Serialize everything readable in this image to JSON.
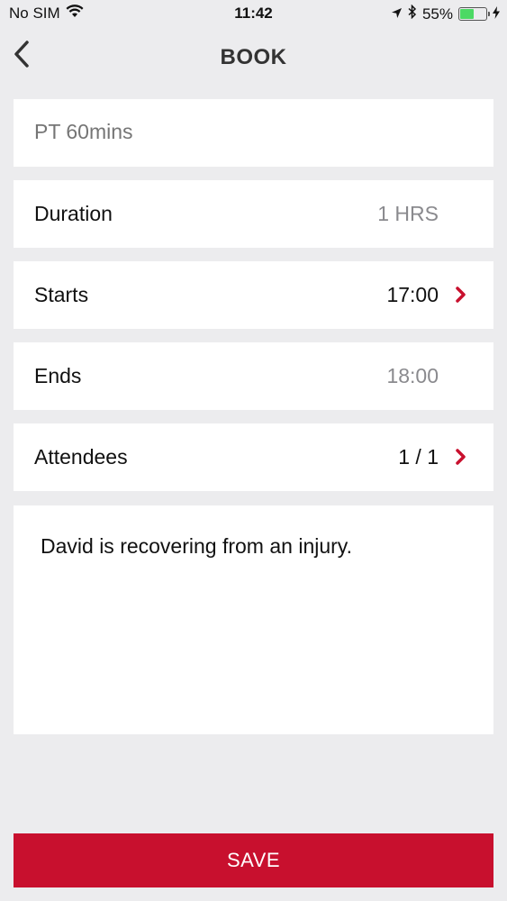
{
  "status_bar": {
    "carrier": "No SIM",
    "time": "11:42",
    "battery_percent": "55%",
    "battery_level": 0.55,
    "icons": [
      "wifi-icon",
      "location-arrow-icon",
      "bluetooth-icon",
      "battery-icon",
      "charging-bolt-icon"
    ]
  },
  "nav": {
    "title": "BOOK",
    "back_icon": "chevron-left-icon"
  },
  "form": {
    "title_placeholder": "PT 60mins",
    "duration": {
      "label": "Duration",
      "value": "1 HRS"
    },
    "starts": {
      "label": "Starts",
      "value": "17:00"
    },
    "ends": {
      "label": "Ends",
      "value": "18:00"
    },
    "attendees": {
      "label": "Attendees",
      "value": "1 / 1"
    },
    "notes": "David is recovering from an injury."
  },
  "actions": {
    "save_label": "SAVE"
  },
  "colors": {
    "accent": "#c8102e",
    "background": "#ececee",
    "muted_text": "#8a8a8e"
  }
}
